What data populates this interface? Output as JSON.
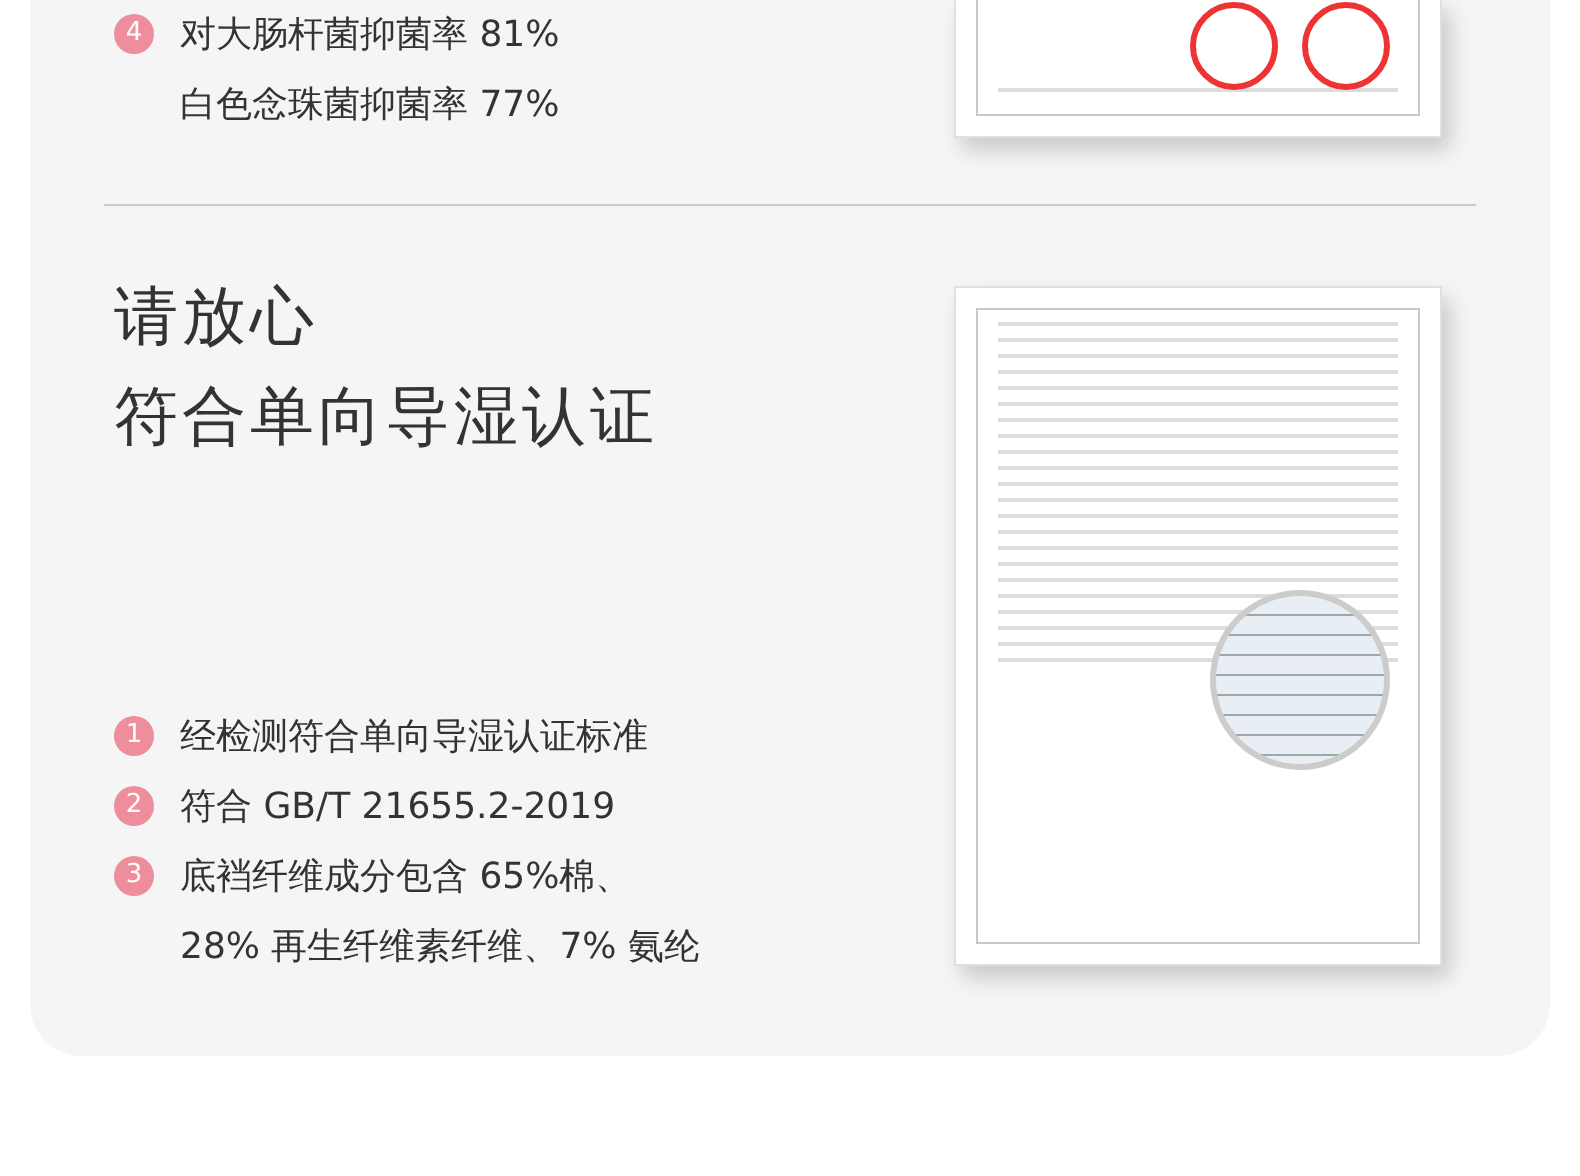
{
  "sections": [
    {
      "items": [
        {
          "number": "4",
          "lines": [
            "对大肠杆菌抑菌率 81%",
            "白色念珠菌抑菌率 77%"
          ]
        }
      ]
    },
    {
      "heading_lines": [
        "请放心",
        "符合单向导湿认证"
      ],
      "items": [
        {
          "number": "1",
          "lines": [
            "经检测符合单向导湿认证标准"
          ]
        },
        {
          "number": "2",
          "lines": [
            "符合 GB/T 21655.2-2019"
          ]
        },
        {
          "number": "3",
          "lines": [
            "底裆纤维成分包含 65%棉、",
            "28% 再生纤维素纤维、7% 氨纶"
          ]
        }
      ]
    }
  ]
}
